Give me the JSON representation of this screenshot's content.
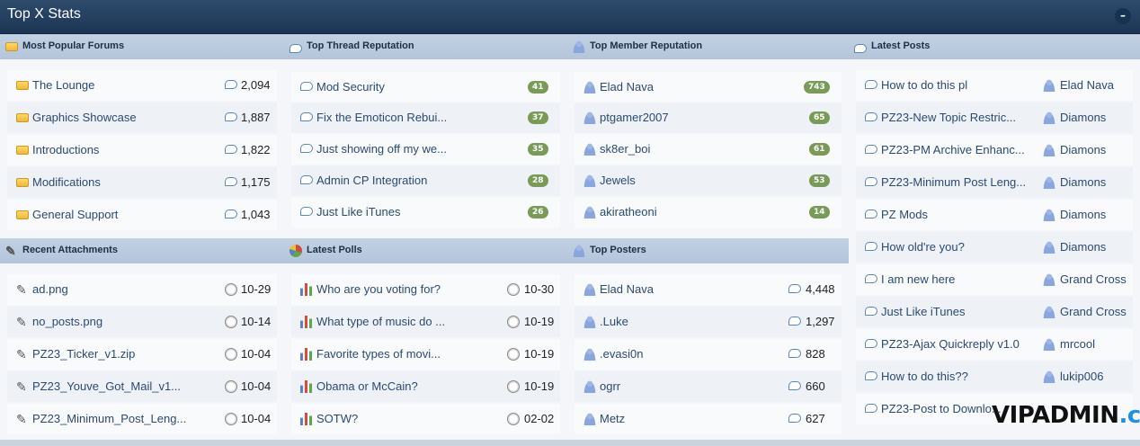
{
  "header": {
    "title": "Top X Stats",
    "collapse": "–"
  },
  "sections": {
    "popular_forums": {
      "title": "Most Popular Forums",
      "rows": [
        {
          "label": "The Lounge",
          "value": "2,094"
        },
        {
          "label": "Graphics Showcase",
          "value": "1,887"
        },
        {
          "label": "Introductions",
          "value": "1,822"
        },
        {
          "label": "Modifications",
          "value": "1,175"
        },
        {
          "label": "General Support",
          "value": "1,043"
        }
      ]
    },
    "thread_reputation": {
      "title": "Top Thread Reputation",
      "rows": [
        {
          "label": "Mod Security",
          "value": "41"
        },
        {
          "label": "Fix the Emoticon Rebui...",
          "value": "37"
        },
        {
          "label": "Just showing off my we...",
          "value": "35"
        },
        {
          "label": "Admin CP Integration",
          "value": "28"
        },
        {
          "label": "Just Like iTunes",
          "value": "26"
        }
      ]
    },
    "member_reputation": {
      "title": "Top Member Reputation",
      "rows": [
        {
          "label": "Elad Nava",
          "value": "743"
        },
        {
          "label": "ptgamer2007",
          "value": "65"
        },
        {
          "label": "sk8er_boi",
          "value": "61"
        },
        {
          "label": "Jewels",
          "value": "53"
        },
        {
          "label": "akiratheoni",
          "value": "14"
        }
      ]
    },
    "latest_posts": {
      "title": "Latest Posts",
      "rows": [
        {
          "label": "How to do this pl",
          "user": "Elad Nava"
        },
        {
          "label": "PZ23-New Topic Restric...",
          "user": "Diamons"
        },
        {
          "label": "PZ23-PM Archive Enhanc...",
          "user": "Diamons"
        },
        {
          "label": "PZ23-Minimum Post Leng...",
          "user": "Diamons"
        },
        {
          "label": "PZ Mods",
          "user": "Diamons"
        },
        {
          "label": "How old're you?",
          "user": "Diamons"
        },
        {
          "label": "I am new here",
          "user": "Grand Cross"
        },
        {
          "label": "Just Like iTunes",
          "user": "Grand Cross"
        },
        {
          "label": "PZ23-Ajax Quickreply v1.0",
          "user": "mrcool"
        },
        {
          "label": "How to do this??",
          "user": "lukip006"
        },
        {
          "label": "PZ23-Post to Downlo...",
          "user": ""
        }
      ]
    },
    "attachments": {
      "title": "Recent Attachments",
      "rows": [
        {
          "label": "ad.png",
          "value": "10-29"
        },
        {
          "label": "no_posts.png",
          "value": "10-14"
        },
        {
          "label": "PZ23_Ticker_v1.zip",
          "value": "10-04"
        },
        {
          "label": "PZ23_Youve_Got_Mail_v1...",
          "value": "10-04"
        },
        {
          "label": "PZ23_Minimum_Post_Leng...",
          "value": "10-04"
        }
      ]
    },
    "polls": {
      "title": "Latest Polls",
      "rows": [
        {
          "label": "Who are you voting for?",
          "value": "10-30"
        },
        {
          "label": "What type of music do ...",
          "value": "10-19"
        },
        {
          "label": "Favorite types of movi...",
          "value": "10-19"
        },
        {
          "label": "Obama or McCain?",
          "value": "10-19"
        },
        {
          "label": "SOTW?",
          "value": "02-02"
        }
      ]
    },
    "top_posters": {
      "title": "Top Posters",
      "rows": [
        {
          "label": "Elad Nava",
          "value": "4,448"
        },
        {
          "label": ".Luke",
          "value": "1,297"
        },
        {
          "label": ".evasi0n",
          "value": "828"
        },
        {
          "label": "ogrr",
          "value": "660"
        },
        {
          "label": "Metz",
          "value": "627"
        }
      ]
    }
  },
  "watermark": {
    "part1": "VIPADMIN",
    "part2": ".club"
  }
}
